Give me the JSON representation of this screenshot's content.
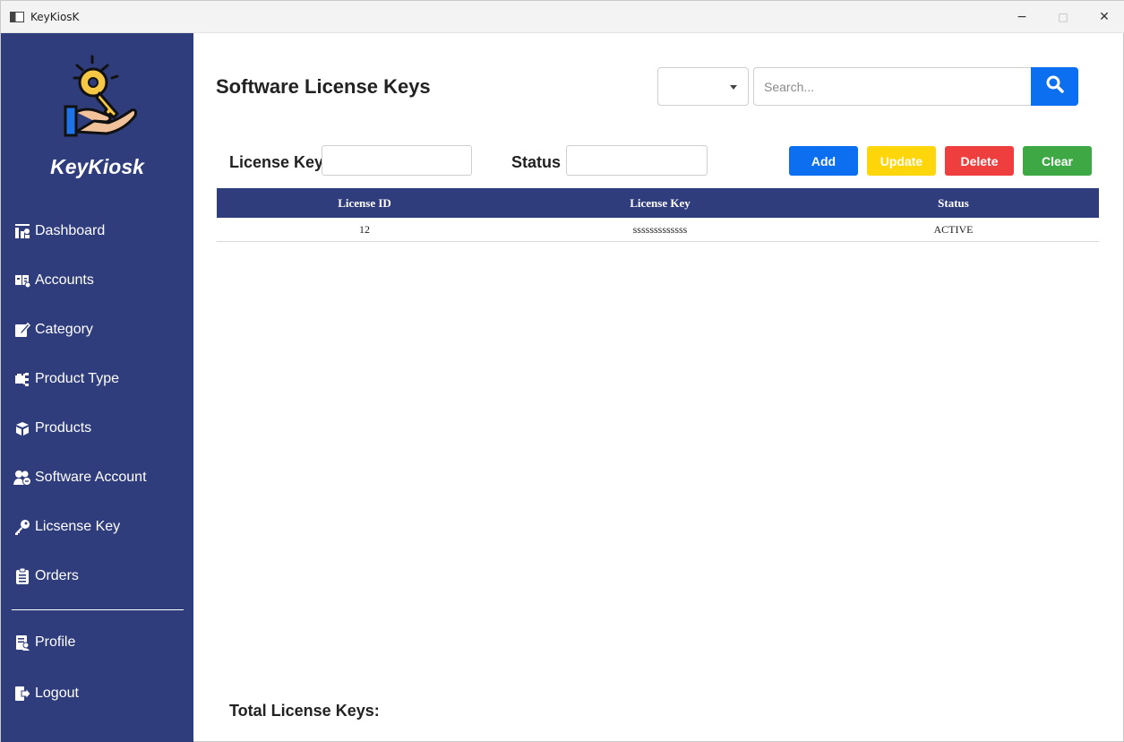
{
  "window": {
    "title": "KeyKiosK",
    "minimize_glyph": "−",
    "maximize_glyph": "□",
    "close_glyph": "✕"
  },
  "sidebar": {
    "brand": "KeyKiosk",
    "logo_icon": "key-hand-icon",
    "items": [
      {
        "label": "Dashboard",
        "icon": "dashboard-icon"
      },
      {
        "label": "Accounts",
        "icon": "accounts-icon"
      },
      {
        "label": "Category",
        "icon": "edit-icon"
      },
      {
        "label": "Product Type",
        "icon": "product-type-icon"
      },
      {
        "label": "Products",
        "icon": "box-icon"
      },
      {
        "label": "Software Account",
        "icon": "user-group-icon"
      },
      {
        "label": "Licsense Key",
        "icon": "key-icon"
      },
      {
        "label": "Orders",
        "icon": "clipboard-icon"
      },
      {
        "label": "Profile",
        "icon": "profile-icon"
      },
      {
        "label": "Logout",
        "icon": "logout-icon"
      }
    ]
  },
  "main": {
    "title": "Software License Keys",
    "filter": {
      "selected": ""
    },
    "search": {
      "placeholder": "Search...",
      "value": ""
    },
    "form": {
      "license_key_label": "License Key",
      "license_key_value": "",
      "status_label": "Status",
      "status_value": ""
    },
    "buttons": {
      "add": "Add",
      "update": "Update",
      "delete": "Delete",
      "clear": "Clear"
    },
    "table": {
      "headers": [
        "License ID",
        "License Key",
        "Status"
      ],
      "rows": [
        [
          "12",
          "sssssssssssss",
          "ACTIVE"
        ]
      ]
    },
    "total_label": "Total License Keys:"
  },
  "colors": {
    "sidebar_bg": "#2f3d7c",
    "primary_blue": "#0b6ff0",
    "update_yellow": "#ffd60a",
    "delete_red": "#ef3e3e",
    "clear_green": "#3ea845"
  }
}
